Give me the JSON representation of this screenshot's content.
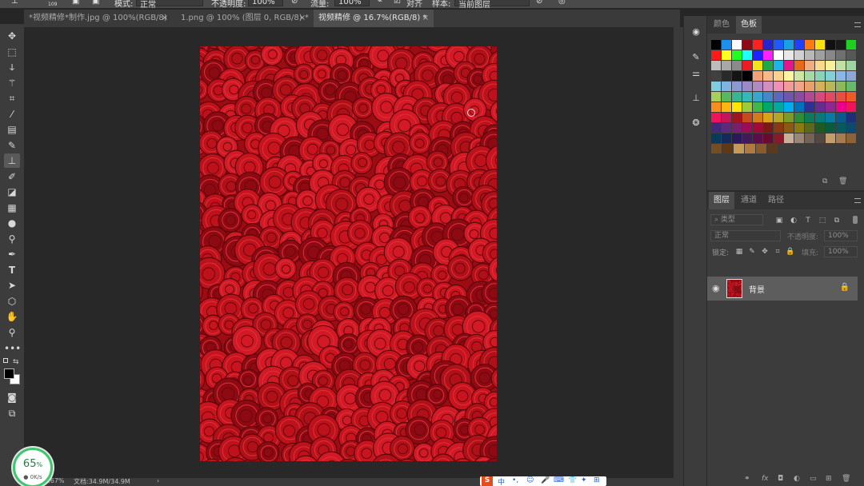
{
  "options_bar": {
    "brush_size": "109",
    "mode_label": "模式:",
    "mode_value": "正常",
    "opacity_label": "不透明度:",
    "opacity_value": "100%",
    "flow_label": "流量:",
    "flow_value": "100%",
    "align_label": "对齐",
    "sample_label": "样本:",
    "sample_value": "当前图层"
  },
  "tabs": [
    {
      "label": "*视频精修*制作.jpg @ 100%(RGB/8)",
      "close": "×"
    },
    {
      "label": "1.png @ 100% (图层 0, RGB/8) *",
      "close": "×"
    },
    {
      "label": "视频精修 @ 16.7%(RGB/8) *",
      "close": "×"
    }
  ],
  "active_tab": 2,
  "tools": [
    "move-tool",
    "marquee-tool",
    "lasso-tool",
    "magic-wand-tool",
    "crop-tool",
    "eyedropper-tool",
    "healing-brush-tool",
    "brush-tool",
    "clone-stamp-tool",
    "history-brush-tool",
    "eraser-tool",
    "gradient-tool",
    "blur-tool",
    "dodge-tool",
    "pen-tool",
    "type-tool",
    "path-selection-tool",
    "shape-tool",
    "hand-tool",
    "zoom-tool",
    "more-tools"
  ],
  "active_tool": "clone-stamp-tool",
  "colors": {
    "foreground": "#000000",
    "background": "#ffffff",
    "document": "#a50d14",
    "accent": "#3fc770"
  },
  "swatch_panel": {
    "tabs": [
      "颜色",
      "色板"
    ],
    "active_tab": 1,
    "swatches": [
      [
        "#000000",
        "#1c8ff0",
        "#ffffff",
        "#8b0a14",
        "#ff2020",
        "#2424d0",
        "#1e5bff",
        "#1aa0e0",
        "#2040ff",
        "#ff7a10",
        "#ffe010",
        "#111111",
        "#1a1a1a",
        "#20d020"
      ],
      [
        "#ff1a1a",
        "#ffff20",
        "#20ff20",
        "#20ffff",
        "#2020ff",
        "#ff20ff",
        "#ffffff",
        "#e8e8e8",
        "#d0d0d0",
        "#b8b8b8",
        "#a0a0a0",
        "#888888",
        "#707070",
        "#585858"
      ],
      [
        "#bdbdbd",
        "#a8a8a8",
        "#8a8a8a",
        "#ed1c24",
        "#f5e31a",
        "#1ea84a",
        "#1cb5e8",
        "#e4168c",
        "#e66a1a",
        "#f0ad80",
        "#fad88c",
        "#f6f09a",
        "#c2e0a4",
        "#9fd4a2"
      ],
      [
        "#404040",
        "#2a2a2a",
        "#141414",
        "#000000",
        "#f4a07a",
        "#f7b98c",
        "#fbd38e",
        "#fef59e",
        "#cde6a4",
        "#a9d8a8",
        "#8dd1b6",
        "#87cfd6",
        "#8ab8e2",
        "#8fa6d6"
      ],
      [
        "#7ecde0",
        "#7fb3e1",
        "#8c9ad4",
        "#9b8ac6",
        "#b28ac3",
        "#d28ec0",
        "#ef91b7",
        "#f39a9a",
        "#f0a48a",
        "#e9a06a",
        "#d6b05a",
        "#b8b85a",
        "#8fb85a",
        "#6ab86a"
      ],
      [
        "#a6d05a",
        "#58b860",
        "#3cb494",
        "#36b6b8",
        "#3aa6cc",
        "#4488c8",
        "#5a6ab8",
        "#7056a8",
        "#8a4c9e",
        "#b04a92",
        "#d64a80",
        "#e24a62",
        "#e84e42",
        "#f05a28"
      ],
      [
        "#f78e1e",
        "#fbb614",
        "#ffe500",
        "#9ccc3c",
        "#43b649",
        "#00a76a",
        "#00a99d",
        "#00aeef",
        "#0072bc",
        "#2e3192",
        "#662d91",
        "#92278f",
        "#ec008c",
        "#ed145b"
      ],
      [
        "#ed145b",
        "#c4145a",
        "#a1161e",
        "#c64a1e",
        "#d47a1a",
        "#d9a21a",
        "#b3a42a",
        "#7a9a2a",
        "#2f8a3a",
        "#0f7a5a",
        "#0a7a78",
        "#0a7ba0",
        "#0a5a8c",
        "#1e2f78"
      ],
      [
        "#3e2a78",
        "#5c2a7a",
        "#7a1e6e",
        "#9e0b57",
        "#9e0b39",
        "#7a1a12",
        "#8a3a12",
        "#8a5a12",
        "#8a7a12",
        "#5a6a1a",
        "#1e5a22",
        "#0a5a3e",
        "#085a5a",
        "#0a4a6e"
      ],
      [
        "#0a3a5a",
        "#142a5a",
        "#2a1a5a",
        "#421a5a",
        "#5a0e4a",
        "#6a0a30",
        "#8a1a2a",
        "#c7b299",
        "#998675",
        "#736357",
        "#534741",
        "#c69c6d",
        "#a67c52",
        "#8c6239"
      ],
      [
        "#754c24",
        "#603913",
        "#c79a5a",
        "#b07a40",
        "#8a5a2a",
        "#5a3a1a"
      ]
    ]
  },
  "layers_panel": {
    "tabs": [
      "图层",
      "通道",
      "路径"
    ],
    "active_tab": 0,
    "filter_label": "类型",
    "blend_mode": "正常",
    "opacity_label": "不透明度:",
    "opacity_value": "100%",
    "lock_label": "锁定:",
    "fill_label": "填充:",
    "fill_value": "100%",
    "layers": [
      {
        "name": "背景",
        "visible": true,
        "locked": true
      }
    ],
    "bottom_icons": [
      "link-icon",
      "fx-icon",
      "mask-icon",
      "adjustment-icon",
      "group-icon",
      "new-layer-icon",
      "delete-icon"
    ]
  },
  "status_bar": {
    "zoom": "16.67%",
    "doc_info": "文档:34.9M/34.9M",
    "arrow": "›"
  },
  "speed_widget": {
    "percent": "65",
    "unit": "%",
    "rate": "0K/s"
  },
  "ime_bar": {
    "logo": "S",
    "lang": "中"
  }
}
